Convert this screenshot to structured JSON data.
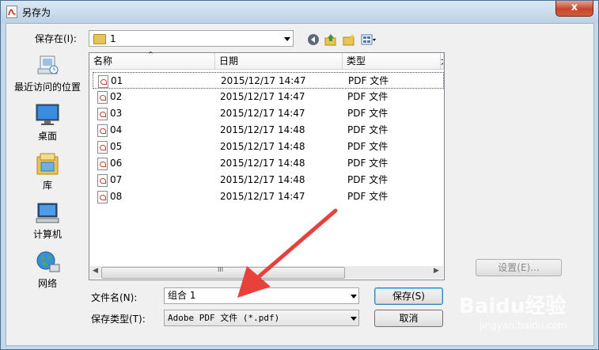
{
  "window": {
    "title": "另存为",
    "close_symbol": "x"
  },
  "lookin": {
    "label": "保存在(I):",
    "value": "1"
  },
  "places": [
    {
      "label": "最近访问的位置",
      "icon": "recent-places-icon"
    },
    {
      "label": "桌面",
      "icon": "desktop-icon"
    },
    {
      "label": "库",
      "icon": "library-icon"
    },
    {
      "label": "计算机",
      "icon": "computer-icon"
    },
    {
      "label": "网络",
      "icon": "network-icon"
    }
  ],
  "columns": {
    "name": "名称",
    "date": "日期",
    "type": "类型",
    "more": "大"
  },
  "files": [
    {
      "name": "01",
      "date": "2015/12/17 14:47",
      "type": "PDF 文件"
    },
    {
      "name": "02",
      "date": "2015/12/17 14:47",
      "type": "PDF 文件"
    },
    {
      "name": "03",
      "date": "2015/12/17 14:47",
      "type": "PDF 文件"
    },
    {
      "name": "04",
      "date": "2015/12/17 14:48",
      "type": "PDF 文件"
    },
    {
      "name": "05",
      "date": "2015/12/17 14:48",
      "type": "PDF 文件"
    },
    {
      "name": "06",
      "date": "2015/12/17 14:48",
      "type": "PDF 文件"
    },
    {
      "name": "07",
      "date": "2015/12/17 14:48",
      "type": "PDF 文件"
    },
    {
      "name": "08",
      "date": "2015/12/17 14:47",
      "type": "PDF 文件"
    }
  ],
  "scroll": {
    "left": "◀",
    "right": "▶",
    "grip": "III"
  },
  "filename": {
    "label": "文件名(N):",
    "value": "组合 1"
  },
  "filetype": {
    "label": "保存类型(T):",
    "value": "Adobe PDF 文件 (*.pdf)"
  },
  "buttons": {
    "settings": "设置(E)...",
    "save": "保存(S)",
    "cancel": "取消"
  },
  "watermark": {
    "logo": "Baidu经验",
    "url": "jingyan.baidu.com"
  },
  "colors": {
    "accent_arrow": "#e8403a",
    "selection_border": "#555555"
  }
}
